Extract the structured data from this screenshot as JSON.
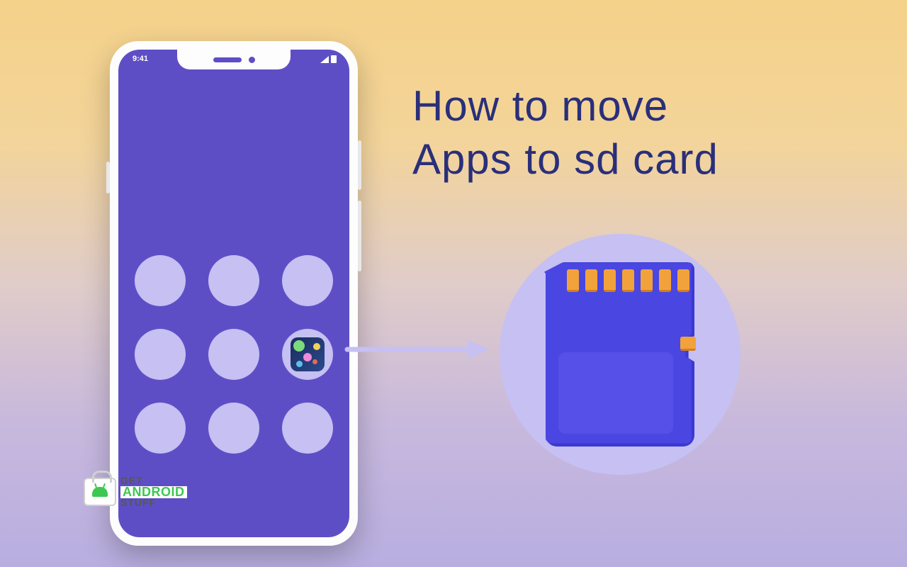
{
  "title_line1": "How to move",
  "title_line2": "Apps to sd card",
  "status": {
    "time": "9:41"
  },
  "watermark": {
    "line1": "GET",
    "line2": "ANDROID",
    "line3": "STUFF"
  }
}
